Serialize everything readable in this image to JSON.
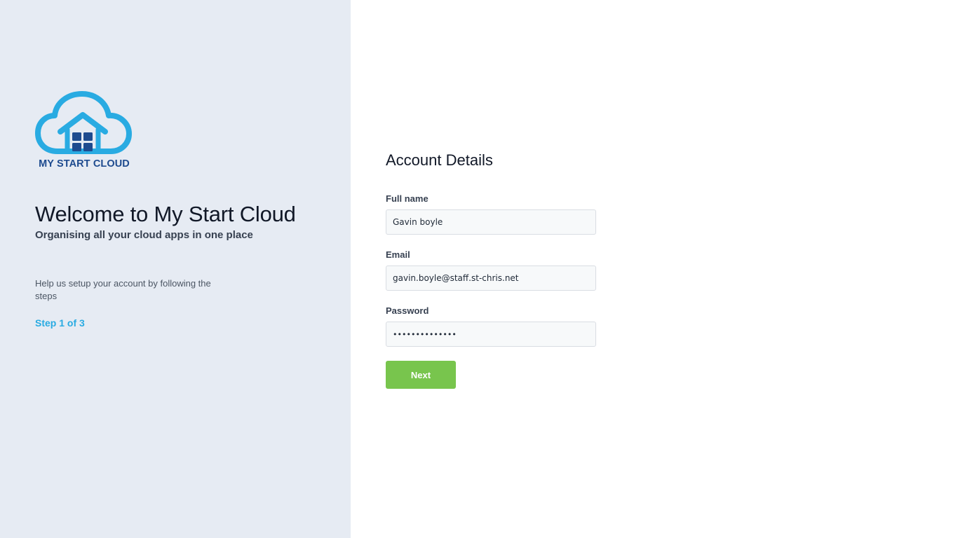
{
  "brand": {
    "logo_text": "MY START CLOUD",
    "colors": {
      "cloud": "#29abe2",
      "house_windows": "#1e4b8f",
      "panel_bg": "#e6ebf3",
      "accent_step": "#29abe2",
      "button_bg": "#78c54d"
    }
  },
  "welcome": {
    "title": "Welcome to My Start Cloud",
    "subtitle": "Organising all your cloud apps in one place",
    "help_text": "Help us setup your account by following the steps",
    "step": "Step 1 of 3"
  },
  "form": {
    "title": "Account Details",
    "full_name": {
      "label": "Full name",
      "value": "Gavin boyle"
    },
    "email": {
      "label": "Email",
      "value": "gavin.boyle@staff.st-chris.net"
    },
    "password": {
      "label": "Password",
      "value": "••••••••••••••"
    },
    "next_label": "Next"
  }
}
